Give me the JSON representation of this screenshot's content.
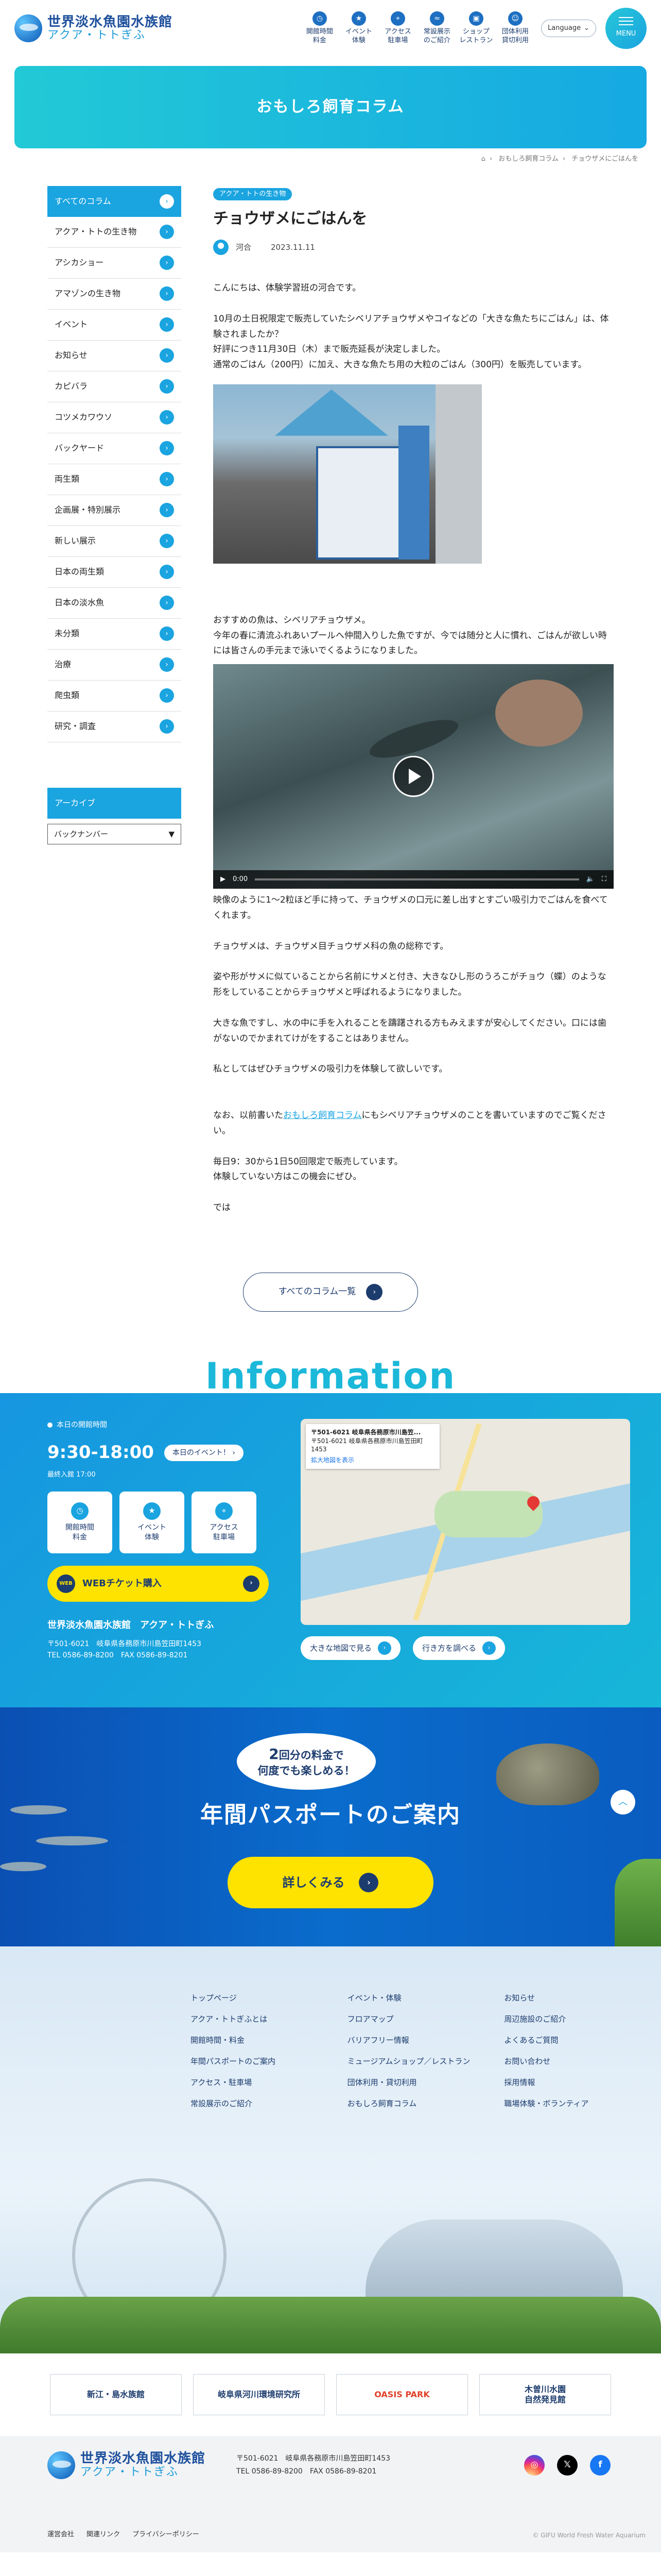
{
  "header": {
    "logo_line1": "世界淡水魚園水族館",
    "logo_line2": "アクア・トトぎふ",
    "nav": [
      {
        "label": "開館時間\n料金",
        "icon": "clock-icon"
      },
      {
        "label": "イベント\n体験",
        "icon": "event-icon"
      },
      {
        "label": "アクセス\n駐車場",
        "icon": "map-pin-icon"
      },
      {
        "label": "常設展示\nのご紹介",
        "icon": "fish-icon"
      },
      {
        "label": "ショップ\nレストラン",
        "icon": "shop-icon"
      },
      {
        "label": "団体利用\n貸切利用",
        "icon": "group-icon"
      }
    ],
    "language": "Language",
    "menu": "MENU"
  },
  "banner": {
    "title": "おもしろ飼育コラム"
  },
  "breadcrumb": [
    "おもしろ飼育コラム",
    "チョウザメにごはんを"
  ],
  "sidebar": {
    "items": [
      "すべてのコラム",
      "アクア・トトの生き物",
      "アシカショー",
      "アマゾンの生き物",
      "イベント",
      "お知らせ",
      "カピバラ",
      "コツメカワウソ",
      "バックヤード",
      "両生類",
      "企画展・特別展示",
      "新しい展示",
      "日本の両生類",
      "日本の淡水魚",
      "未分類",
      "治療",
      "爬虫類",
      "研究・調査"
    ],
    "archive_title": "アーカイブ",
    "archive_select": "バックナンバー"
  },
  "article": {
    "tag": "アクア・トトの生き物",
    "title": "チョウザメにごはんを",
    "author": "河合",
    "date": "2023.11.11",
    "p1": "こんにちは、体験学習班の河合です。",
    "p2": "10月の土日祝限定で販売していたシベリアチョウザメやコイなどの「大きな魚たちにごはん」は、体験されましたか？",
    "p3": "好評につき11月30日（木）まで販売延長が決定しました。",
    "p4": "通常のごはん（200円）に加え、大きな魚たち用の大粒のごはん（300円）を販売しています。",
    "p5": "おすすめの魚は、シベリアチョウザメ。",
    "p6": "今年の春に清流ふれあいプールへ仲間入りした魚ですが、今では随分と人に慣れ、ごはんが欲しい時には皆さんの手元まで泳いでくるようになりました。",
    "video_time": "0:00",
    "video_progress": 0,
    "p7": "映像のように1～2粒ほど手に持って、チョウザメの口元に差し出すとすごい吸引力でごはんを食べてくれます。",
    "p8": "チョウザメは、チョウザメ目チョウザメ科の魚の総称です。",
    "p9": "姿や形がサメに似ていることから名前にサメと付き、大きなひし形のうろこがチョウ（蝶）のような形をしていることからチョウザメと呼ばれるようになりました。",
    "p10": "大きな魚ですし、水の中に手を入れることを躊躇される方もみえますが安心してください。口には歯がないのでかまれてけがをすることはありません。",
    "p11": "私としてはぜひチョウザメの吸引力を体験して欲しいです。",
    "p12_pre": "なお、以前書いた",
    "p12_link": "おもしろ飼育コラム",
    "p12_post": "にもシベリアチョウザメのことを書いていますのでご覧ください。",
    "p13": "毎日9：30から1日50回限定で販売しています。",
    "p14": "体験していない方はこの機会にぜひ。",
    "p15": "では",
    "all_button": "すべてのコラム一覧"
  },
  "information": {
    "heading": "Information",
    "today_label": "本日の開館時間",
    "hours": "9:30-18:00",
    "last_entry": "最終入館 17:00",
    "today_event": "本日のイベント！",
    "tiles": [
      {
        "label": "開館時間\n料金",
        "icon": "clock-icon"
      },
      {
        "label": "イベント\n体験",
        "icon": "event-icon"
      },
      {
        "label": "アクセス\n駐車場",
        "icon": "map-pin-icon"
      }
    ],
    "ticket_badge": "WEB",
    "ticket": "WEBチケット購入",
    "facility": "世界淡水魚園水族館　アクア・トトぎふ",
    "address": "〒501-6021　岐阜県各務原市川島笠田町1453",
    "tel": "TEL 0586-89-8200　FAX 0586-89-8201",
    "map_card_title": "〒501-6021 岐阜県各務原市川島笠...",
    "map_card_addr": "〒501-6021 岐阜県各務原市川島笠田町 1453",
    "map_card_link": "拡大地図を表示",
    "map_big": "大きな地図で見る",
    "map_route": "行き方を調べる"
  },
  "pass": {
    "line1a": "2",
    "line1b": "回分の料金で",
    "line2": "何度でも楽しめる！",
    "title": "年間パスポートのご案内",
    "more": "詳しくみる"
  },
  "footer_nav": {
    "col1": [
      "トップページ",
      "アクア・トトぎふとは",
      "開館時間・料金",
      "年間パスポートのご案内",
      "アクセス・駐車場",
      "常設展示のご紹介"
    ],
    "col2": [
      "イベント・体験",
      "フロアマップ",
      "バリアフリー情報",
      "ミュージアムショップ／レストラン",
      "団体利用・貸切利用",
      "おもしろ飼育コラム"
    ],
    "col3": [
      "お知らせ",
      "周辺施設のご紹介",
      "よくあるご質問",
      "お問い合わせ",
      "採用情報",
      "職場体験・ボランティア"
    ]
  },
  "partners": [
    "新江・島水族館",
    "岐阜県河川環境研究所",
    "OASIS PARK",
    "木曽川水園\n自然発見館"
  ],
  "footer": {
    "address": "〒501-6021　岐阜県各務原市川島笠田町1453",
    "tel": "TEL 0586-89-8200　FAX 0586-89-8201",
    "links": [
      "運営会社",
      "関連リンク",
      "プライバシーポリシー"
    ],
    "copyright": "© GIFU World Fresh Water Aquarium"
  },
  "colors": {
    "accent": "#1aa4e0",
    "navy": "#1d3c6e",
    "yellow": "#ffe300"
  }
}
